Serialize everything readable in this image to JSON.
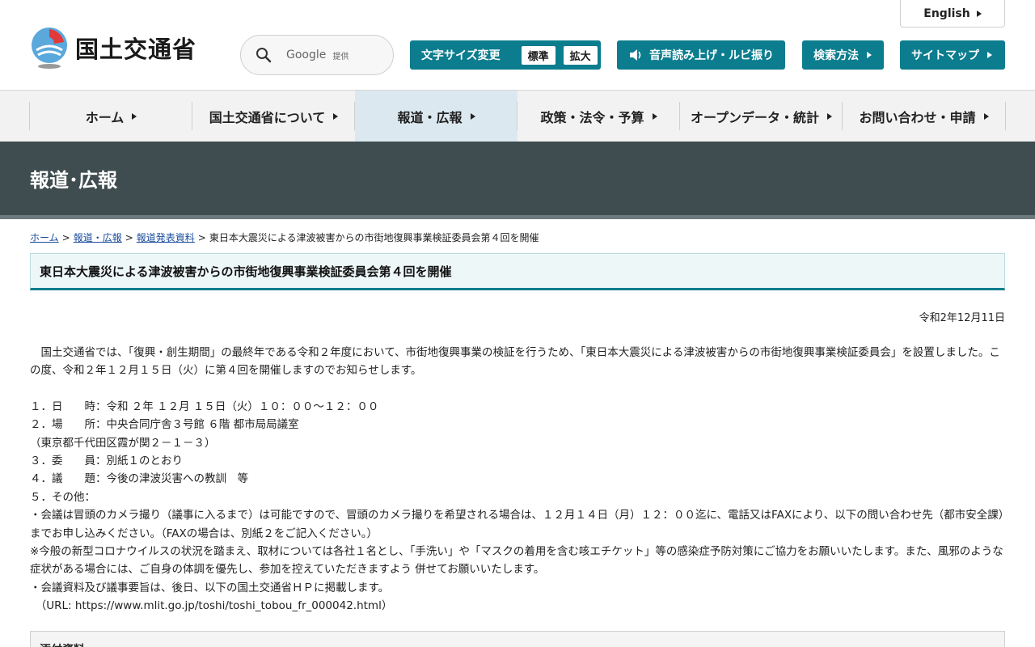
{
  "header": {
    "logo_text": "国土交通省",
    "search": {
      "brand": "Google",
      "provided": "提供"
    },
    "english_label": "English",
    "font_size": {
      "label": "文字サイズ変更",
      "standard": "標準",
      "large": "拡大"
    },
    "speech_label": "音声読み上げ・ルビ振り",
    "search_method_label": "検索方法",
    "sitemap_label": "サイトマップ"
  },
  "nav": {
    "items": [
      {
        "label": "ホーム"
      },
      {
        "label": "国土交通省について"
      },
      {
        "label": "報道・広報"
      },
      {
        "label": "政策・法令・予算"
      },
      {
        "label": "オープンデータ・統計"
      },
      {
        "label": "お問い合わせ・申請"
      }
    ]
  },
  "banner": {
    "title": "報道･広報"
  },
  "breadcrumb": {
    "home": "ホーム",
    "press": "報道・広報",
    "releases": "報道発表資料",
    "current": "東日本大震災による津波被害からの市街地復興事業検証委員会第４回を開催",
    "separator": ">"
  },
  "page": {
    "title": "東日本大震災による津波被害からの市街地復興事業検証委員会第４回を開催",
    "date": "令和2年12月11日",
    "intro": "国土交通省では、「復興・創生期間」の最終年である令和２年度において、市街地復興事業の検証を行うため、「東日本大震災による津波被害からの市街地復興事業検証委員会」を設置しました。この度、令和２年１２月１５日（火）に第４回を開催しますのでお知らせします。",
    "lines": [
      "１．日　　時：令和 ２年 １２月 １５日（火）１０：００～１２：００",
      "２．場　　所：中央合同庁舎３号館 ６階 都市局局議室",
      "（東京都千代田区霞が関２－１－３）",
      "３．委　　員：別紙１のとおり",
      "４．議　　題：今後の津波災害への教訓　等",
      "５．その他：",
      "・会議は冒頭のカメラ撮り（議事に入るまで）は可能ですので、冒頭のカメラ撮りを希望される場合は、１２月１４日（月）１２：００迄に、電話又はFAXにより、以下の問い合わせ先（都市安全課）までお申し込みください。（FAXの場合は、別紙２をご記入ください。）",
      "※今般の新型コロナウイルスの状況を踏まえ、取材については各社１名とし、「手洗い」や「マスクの着用を含む咳エチケット」等の感染症予防対策にご協力をお願いいたします。また、風邪のような症状がある場合には、ご自身の体調を優先し、参加を控えていただきますよう 併せてお願いいたします。",
      "・会議資料及び議事要旨は、後日、以下の国土交通省ＨＰに掲載します。",
      "　（URL: https://www.mlit.go.jp/toshi/toshi_tobou_fr_000042.html）"
    ],
    "attachments_heading": "添付資料"
  },
  "colors": {
    "teal": "#0b7d8e",
    "banner": "#3f4c50",
    "nav_active": "#dce8f0"
  }
}
